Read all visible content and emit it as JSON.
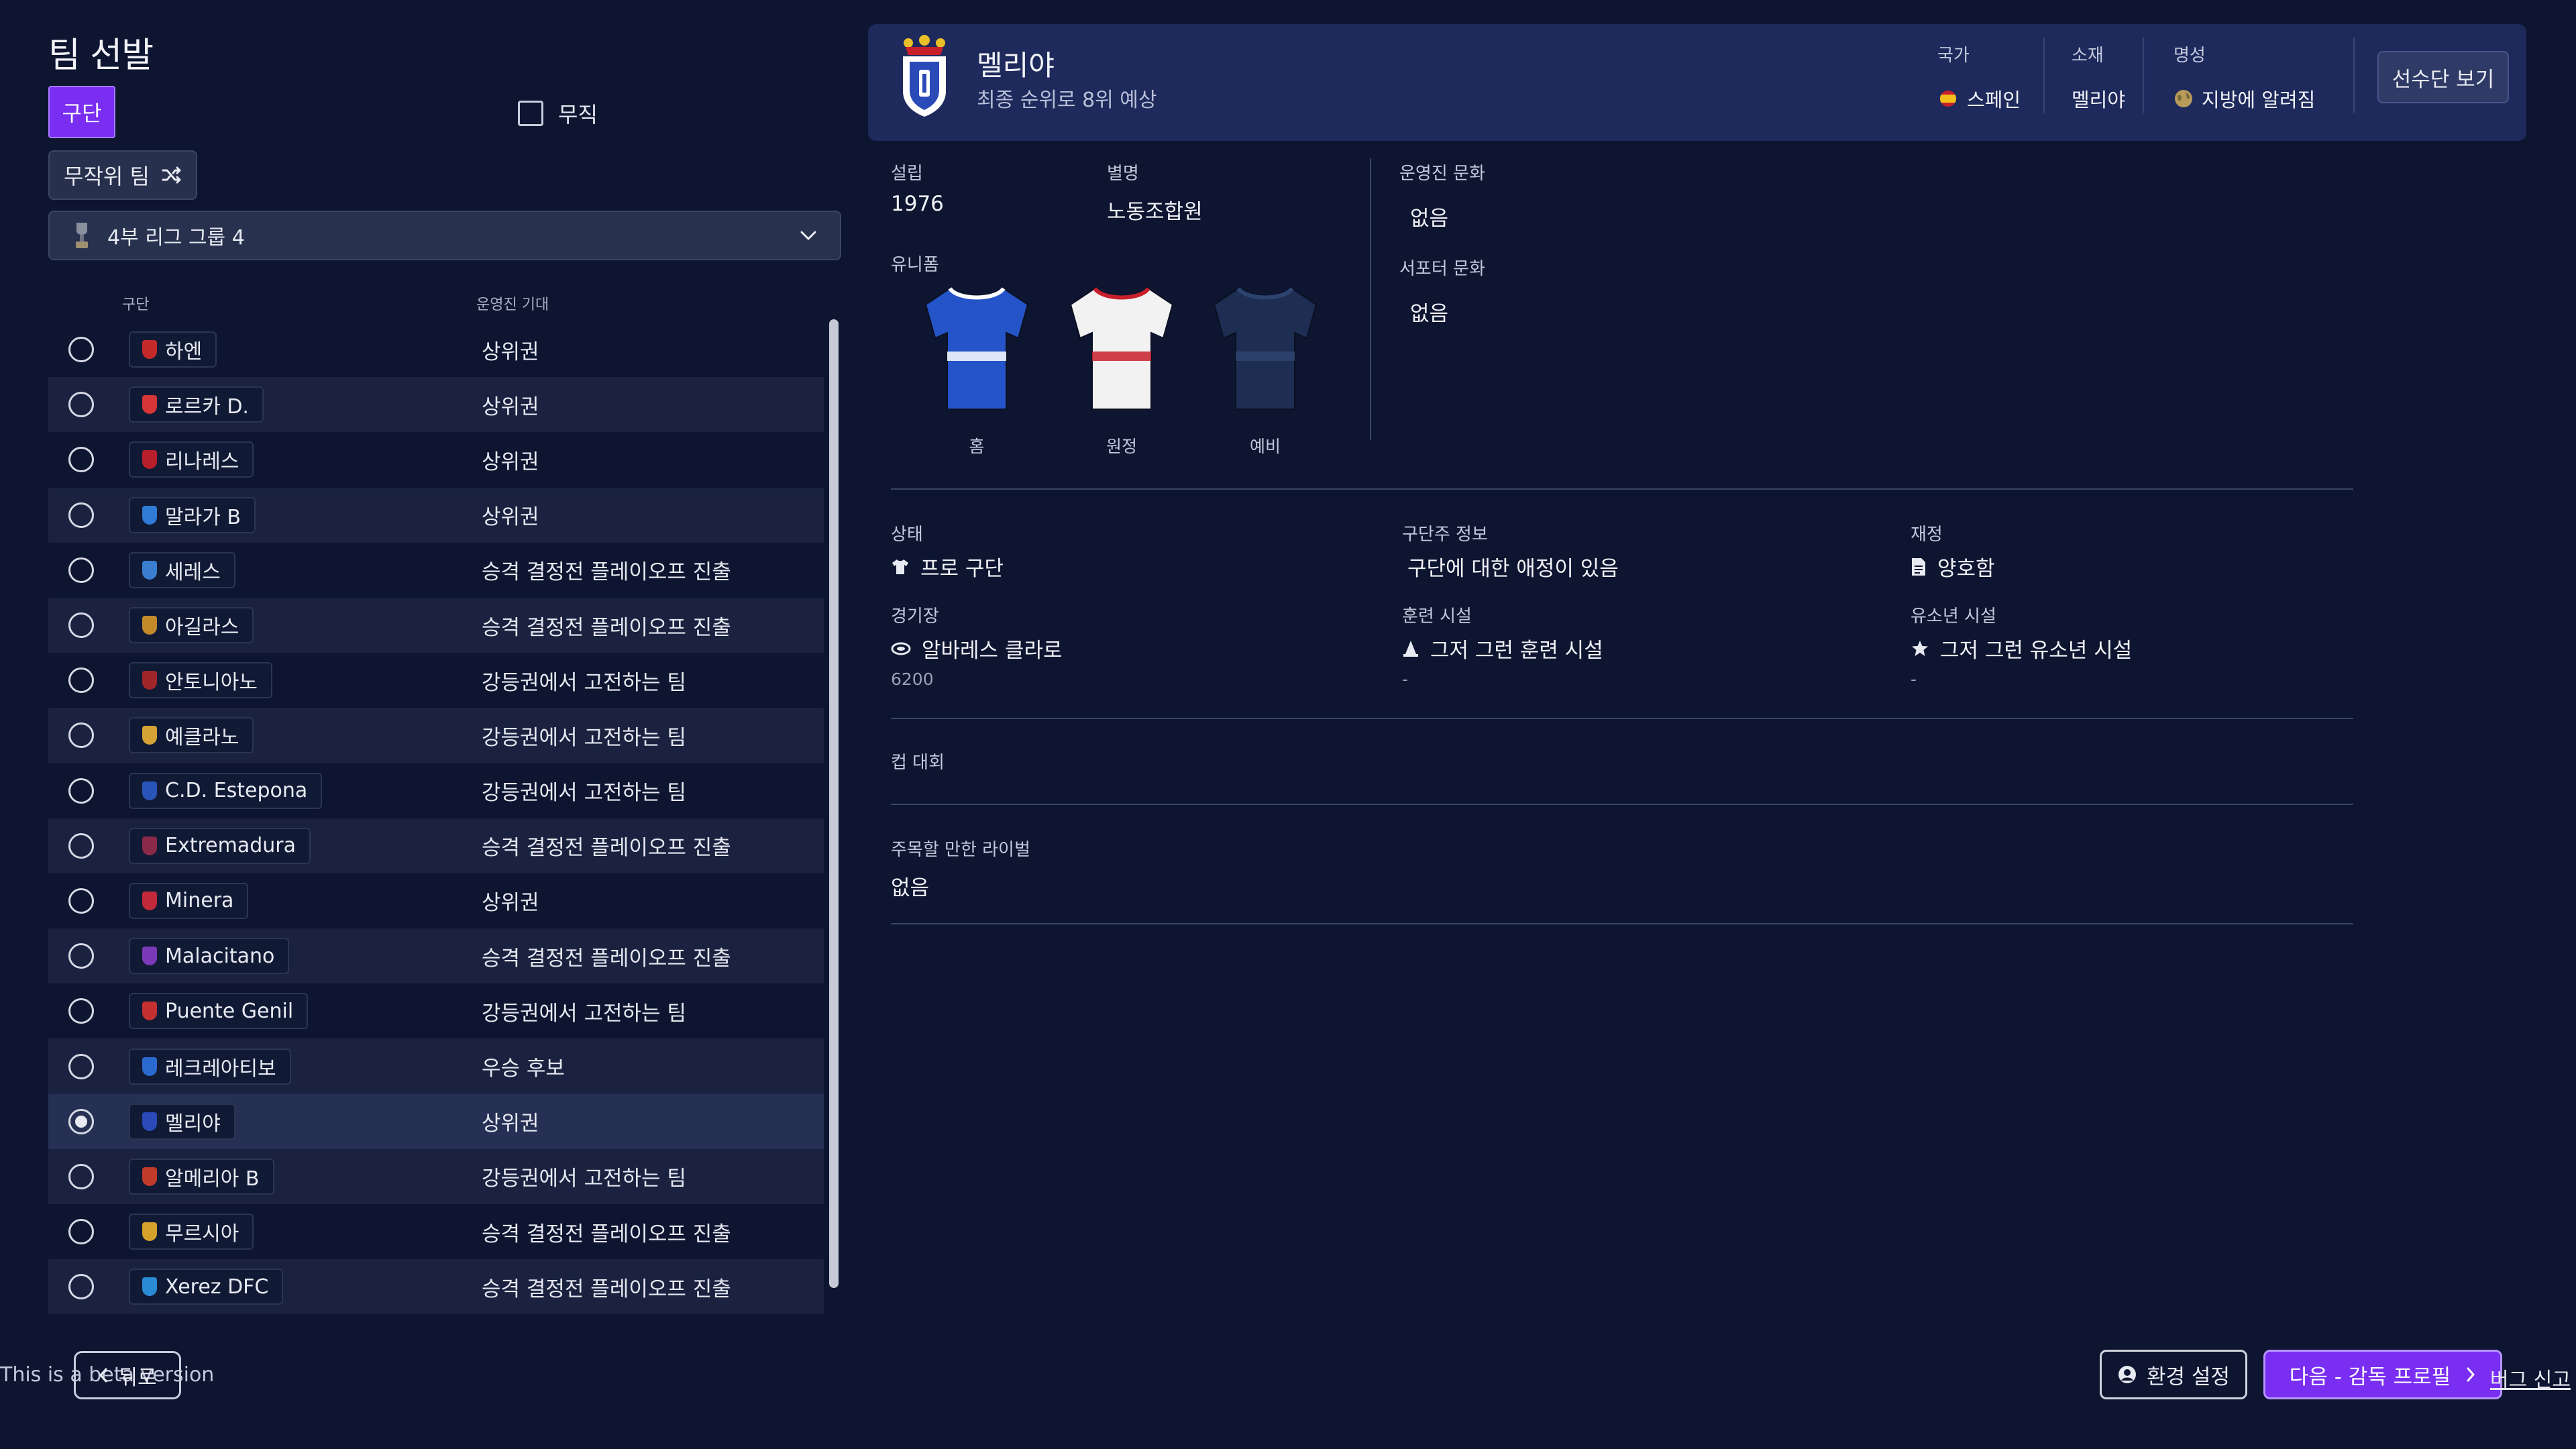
{
  "page_title": "팀 선발",
  "tabs": {
    "club": "구단",
    "unemployed": "무직"
  },
  "random_team": "무작위 팀",
  "league_select": "4부 리그 그룹 4",
  "columns": {
    "club": "구단",
    "board_expectation": "운영진 기대"
  },
  "clubs": [
    {
      "name": "하엔",
      "expectation": "상위권",
      "crest": "#c42a2a"
    },
    {
      "name": "로르카 D.",
      "expectation": "상위권",
      "crest": "#d63636"
    },
    {
      "name": "리나레스",
      "expectation": "상위권",
      "crest": "#b81f2a"
    },
    {
      "name": "말라가 B",
      "expectation": "상위권",
      "crest": "#2f7bd6"
    },
    {
      "name": "세레스",
      "expectation": "승격 결정전 플레이오프 진출",
      "crest": "#3a7ed0"
    },
    {
      "name": "아길라스",
      "expectation": "승격 결정전 플레이오프 진출",
      "crest": "#c28a2a"
    },
    {
      "name": "안토니아노",
      "expectation": "강등권에서 고전하는 팀",
      "crest": "#a0262a"
    },
    {
      "name": "예클라노",
      "expectation": "강등권에서 고전하는 팀",
      "crest": "#d4a235"
    },
    {
      "name": "C.D. Estepona",
      "expectation": "강등권에서 고전하는 팀",
      "crest": "#2a55b8"
    },
    {
      "name": "Extremadura",
      "expectation": "승격 결정전 플레이오프 진출",
      "crest": "#8a2a4a"
    },
    {
      "name": "Minera",
      "expectation": "상위권",
      "crest": "#c22a3a"
    },
    {
      "name": "Malacitano",
      "expectation": "승격 결정전 플레이오프 진출",
      "crest": "#7a3ab8"
    },
    {
      "name": "Puente Genil",
      "expectation": "강등권에서 고전하는 팀",
      "crest": "#c23030"
    },
    {
      "name": "레크레아티보",
      "expectation": "우승 후보",
      "crest": "#2a6ad0"
    },
    {
      "name": "멜리야",
      "expectation": "상위권",
      "crest": "#2a4ab8",
      "selected": true
    },
    {
      "name": "알메리아 B",
      "expectation": "강등권에서 고전하는 팀",
      "crest": "#c23a2a"
    },
    {
      "name": "무르시아",
      "expectation": "승격 결정전 플레이오프 진출",
      "crest": "#d4a22a"
    },
    {
      "name": "Xerez DFC",
      "expectation": "승격 결정전 플레이오프 진출",
      "crest": "#2a8ad4"
    }
  ],
  "header": {
    "club_name": "멜리야",
    "subtitle": "최종 순위로 8위 예상",
    "nation_label": "국가",
    "nation_value": "스페인",
    "location_label": "소재",
    "location_value": "멜리야",
    "reputation_label": "명성",
    "reputation_value": "지방에 알려짐",
    "squad_button": "선수단 보기"
  },
  "info": {
    "founded_label": "설립",
    "founded_value": "1976",
    "nickname_label": "별명",
    "nickname_value": "노동조합원",
    "board_culture_label": "운영진 문화",
    "board_culture_value": "없음",
    "supporter_culture_label": "서포터 문화",
    "supporter_culture_value": "없음",
    "kits_label": "유니폼",
    "kits": [
      {
        "label": "홈",
        "body": "#2454c8",
        "trim": "#ffffff"
      },
      {
        "label": "원정",
        "body": "#f2f2f2",
        "trim": "#c8202a"
      },
      {
        "label": "예비",
        "body": "#1e2e52",
        "trim": "#2e4470"
      }
    ],
    "status_label": "상태",
    "status_value": "프로 구단",
    "owner_label": "구단주 정보",
    "owner_value": "구단에 대한 애정이 있음",
    "finance_label": "재정",
    "finance_value": "양호함",
    "stadium_label": "경기장",
    "stadium_value": "알바레스 클라로",
    "stadium_capacity": "6200",
    "training_label": "훈련 시설",
    "training_value": "그저 그런 훈련 시설",
    "training_sub": "-",
    "youth_label": "유소년 시설",
    "youth_value": "그저 그런 유소년 시설",
    "youth_sub": "-",
    "cups_label": "컵 대회",
    "rivals_label": "주목할 만한 라이벌",
    "rivals_value": "없음"
  },
  "footer": {
    "beta_text": "This is a beta version",
    "back": "뒤로",
    "settings": "환경 설정",
    "next": "다음 - 감독 프로필",
    "bug_report": "버그 신고"
  }
}
